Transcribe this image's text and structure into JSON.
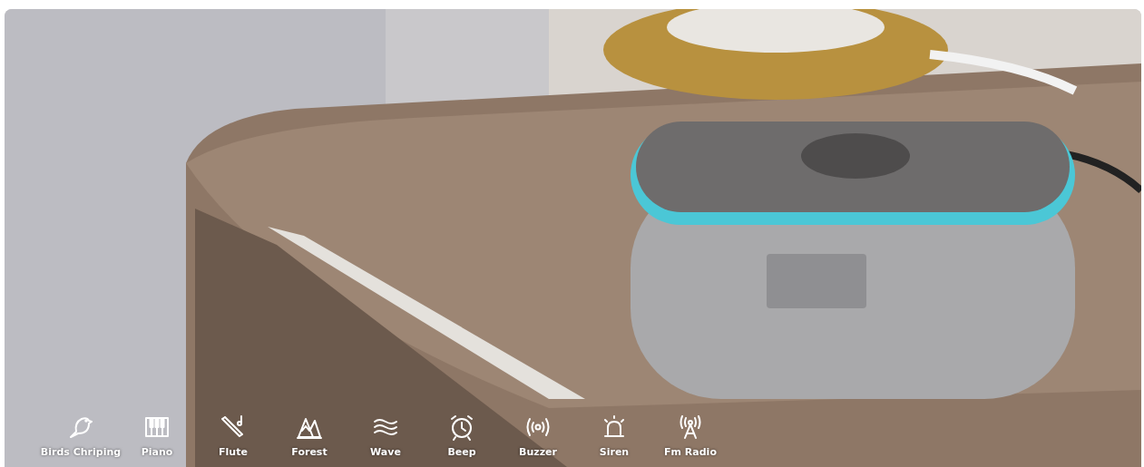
{
  "banner": {
    "kind": "picture",
    "sounds": [
      {
        "label": "Birds Chriping"
      },
      {
        "label": "Piano"
      },
      {
        "label": "Flute"
      },
      {
        "label": "Forest"
      },
      {
        "label": "Wave"
      },
      {
        "label": "Beep"
      },
      {
        "label": "Buzzer"
      },
      {
        "label": "Siren"
      },
      {
        "label": "Fm Radio"
      }
    ]
  }
}
